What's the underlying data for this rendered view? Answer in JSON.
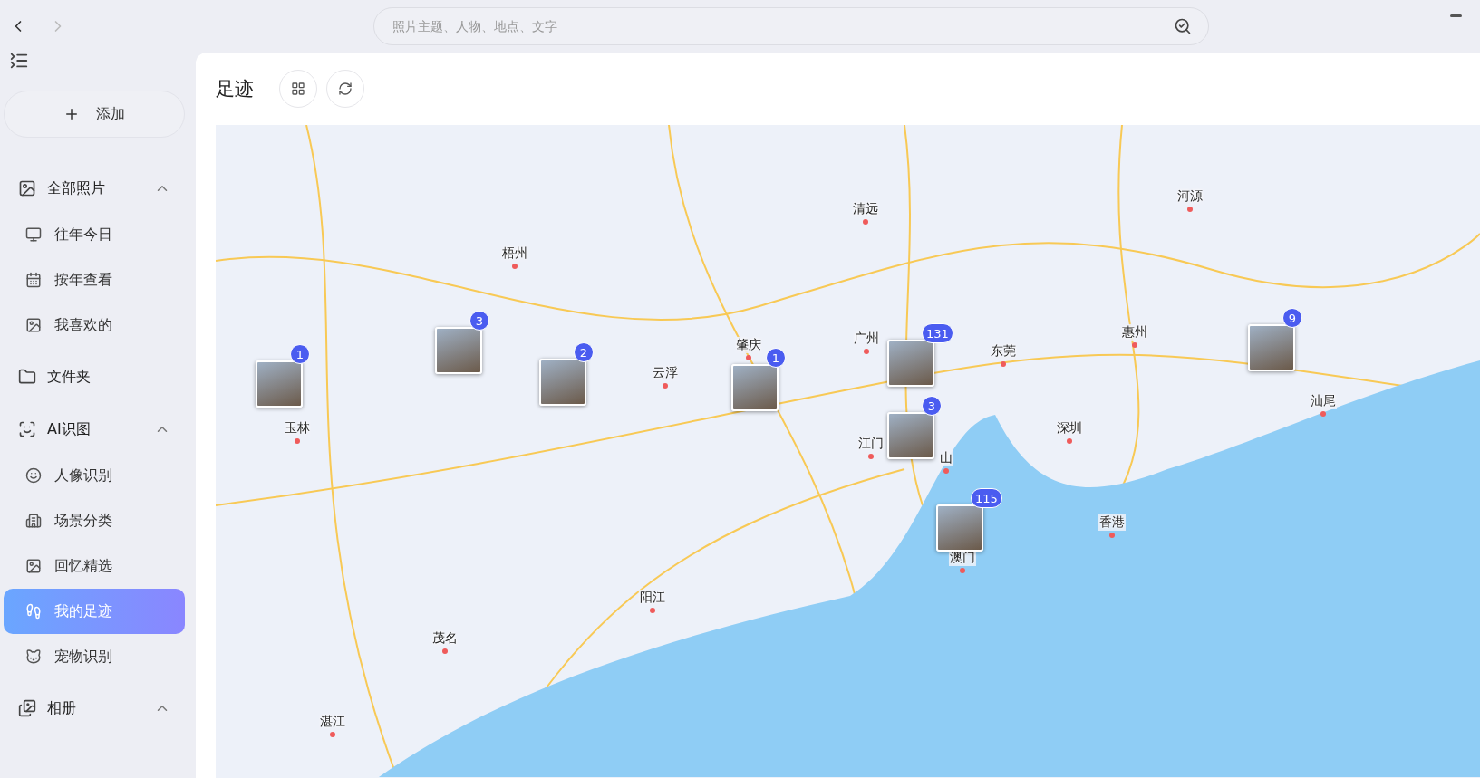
{
  "search": {
    "placeholder": "照片主题、人物、地点、文字"
  },
  "add_button": {
    "label": "添加"
  },
  "sidebar": {
    "groups": [
      {
        "label": "全部照片",
        "expanded": true,
        "children": [
          {
            "label": "往年今日",
            "selected": false
          },
          {
            "label": "按年查看",
            "selected": false
          },
          {
            "label": "我喜欢的",
            "selected": false
          }
        ]
      },
      {
        "label": "文件夹"
      },
      {
        "label": "AI识图",
        "expanded": true,
        "children": [
          {
            "label": "人像识别",
            "selected": false
          },
          {
            "label": "场景分类",
            "selected": false
          },
          {
            "label": "回忆精选",
            "selected": false
          },
          {
            "label": "我的足迹",
            "selected": true
          },
          {
            "label": "宠物识别",
            "selected": false
          }
        ]
      },
      {
        "label": "相册",
        "expanded": true
      }
    ]
  },
  "page": {
    "title": "足迹"
  },
  "map": {
    "cities": [
      "清远",
      "河源",
      "梧州",
      "肇庆",
      "广州",
      "东莞",
      "惠州",
      "云浮",
      "玉林",
      "江门",
      "山",
      "深圳",
      "汕尾",
      "香港",
      "澳门",
      "阳江",
      "茂名",
      "湛江"
    ],
    "markers": [
      {
        "count": "1"
      },
      {
        "count": "3"
      },
      {
        "count": "2"
      },
      {
        "count": "1"
      },
      {
        "count": "131"
      },
      {
        "count": "3"
      },
      {
        "count": "115"
      },
      {
        "count": "9"
      }
    ]
  }
}
